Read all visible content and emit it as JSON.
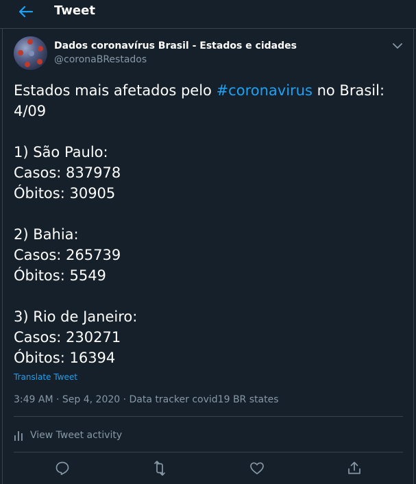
{
  "header": {
    "title": "Tweet",
    "back_icon": "arrow-left-icon",
    "accent": "#1da1f2"
  },
  "author": {
    "name": "Dados coronavírus Brasil - Estados e cidades",
    "handle": "@coronaBRestados"
  },
  "tweet": {
    "intro_before": "Estados mais afetados pelo ",
    "hashtag": "#coronavirus",
    "intro_after": " no Brasil:",
    "date": "4/09",
    "states": [
      {
        "title": "1) São Paulo:",
        "cases": "Casos: 837978",
        "deaths": "Óbitos: 30905"
      },
      {
        "title": "2) Bahia:",
        "cases": "Casos: 265739",
        "deaths": "Óbitos: 5549"
      },
      {
        "title": "3) Rio de Janeiro:",
        "cases": "Casos: 230271",
        "deaths": "Óbitos: 16394"
      }
    ],
    "translate_label": "Translate Tweet"
  },
  "meta": {
    "timestamp": "3:49 AM · Sep 4, 2020",
    "separator": " · ",
    "source": "Data tracker covid19 BR states"
  },
  "activity": {
    "label": "View Tweet activity",
    "icon": "bar-chart-icon"
  },
  "actions": {
    "reply_icon": "reply-icon",
    "retweet_icon": "retweet-icon",
    "like_icon": "heart-icon",
    "share_icon": "share-icon"
  },
  "colors": {
    "background": "#15202b",
    "border": "#38444d",
    "secondary_text": "#8899a6"
  }
}
